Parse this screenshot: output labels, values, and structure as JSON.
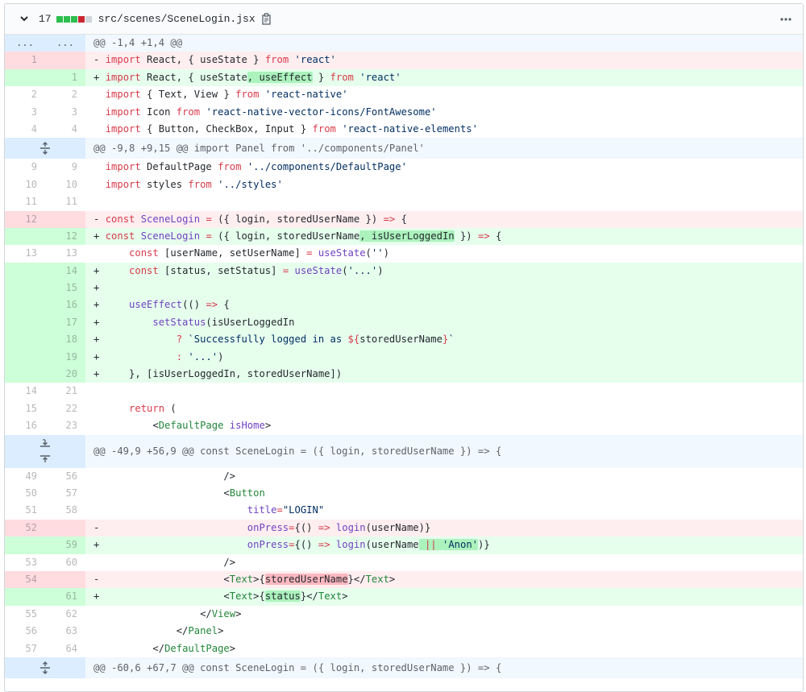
{
  "file": {
    "changes": "17",
    "path": "src/scenes/SceneLogin.jsx",
    "diffstat_colors": [
      "#2cbe4e",
      "#2cbe4e",
      "#2cbe4e",
      "#cb2431",
      "#d1d5da"
    ]
  },
  "header": {
    "dots_old": "...",
    "dots_new": "..."
  },
  "hunks": [
    "@@ -1,4 +1,4 @@",
    "@@ -9,8 +9,15 @@ import Panel from '../components/Panel'",
    "@@ -49,9 +56,9 @@ const SceneLogin = ({ login, storedUserName }) => {",
    "@@ -60,6 +67,7 @@ const SceneLogin = ({ login, storedUserName }) => {"
  ],
  "lines": [
    {
      "old": "1",
      "new": ""
    },
    {
      "old": "",
      "new": "1"
    },
    {
      "old": "2",
      "new": "2"
    },
    {
      "old": "3",
      "new": "3"
    },
    {
      "old": "4",
      "new": "4"
    },
    {
      "old": "9",
      "new": "9"
    },
    {
      "old": "10",
      "new": "10"
    },
    {
      "old": "11",
      "new": "11"
    },
    {
      "old": "12",
      "new": ""
    },
    {
      "old": "",
      "new": "12"
    },
    {
      "old": "13",
      "new": "13"
    },
    {
      "old": "",
      "new": "14"
    },
    {
      "old": "",
      "new": "15"
    },
    {
      "old": "",
      "new": "16"
    },
    {
      "old": "",
      "new": "17"
    },
    {
      "old": "",
      "new": "18"
    },
    {
      "old": "",
      "new": "19"
    },
    {
      "old": "",
      "new": "20"
    },
    {
      "old": "14",
      "new": "21"
    },
    {
      "old": "15",
      "new": "22"
    },
    {
      "old": "16",
      "new": "23"
    },
    {
      "old": "49",
      "new": "56"
    },
    {
      "old": "50",
      "new": "57"
    },
    {
      "old": "51",
      "new": "58"
    },
    {
      "old": "52",
      "new": ""
    },
    {
      "old": "",
      "new": "59"
    },
    {
      "old": "53",
      "new": "60"
    },
    {
      "old": "54",
      "new": ""
    },
    {
      "old": "",
      "new": "61"
    },
    {
      "old": "55",
      "new": "62"
    },
    {
      "old": "56",
      "new": "63"
    },
    {
      "old": "57",
      "new": "64"
    }
  ],
  "code": {
    "l1": [
      "- ",
      "import",
      " React, { useState } ",
      "from",
      " ",
      "'react'"
    ],
    "l2": [
      "+ ",
      "import",
      " React, { useState",
      ", useEffect",
      " } ",
      "from",
      " ",
      "'react'"
    ],
    "l3": [
      "  ",
      "import",
      " { Text, View } ",
      "from",
      " ",
      "'react-native'"
    ],
    "l4": [
      "  ",
      "import",
      " Icon ",
      "from",
      " ",
      "'react-native-vector-icons/FontAwesome'"
    ],
    "l5": [
      "  ",
      "import",
      " { Button, CheckBox, Input } ",
      "from",
      " ",
      "'react-native-elements'"
    ],
    "l6": [
      "  ",
      "import",
      " DefaultPage ",
      "from",
      " ",
      "'../components/DefaultPage'"
    ],
    "l7": [
      "  ",
      "import",
      " styles ",
      "from",
      " ",
      "'../styles'"
    ],
    "l8": [
      ""
    ],
    "l9": [
      "- ",
      "const",
      " ",
      "SceneLogin",
      " ",
      "=",
      " ({ login, storedUserName }) ",
      "=>",
      " {"
    ],
    "l10": [
      "+ ",
      "const",
      " ",
      "SceneLogin",
      " ",
      "=",
      " ({ login, storedUserName",
      ", isUserLoggedIn",
      " }) ",
      "=>",
      " {"
    ],
    "l11": [
      "      ",
      "const",
      " [userName, setUserName] ",
      "=",
      " ",
      "useState",
      "(",
      "''",
      ")"
    ],
    "l12": [
      "+     ",
      "const",
      " [status, setStatus] ",
      "=",
      " ",
      "useState",
      "(",
      "'...'",
      ")"
    ],
    "l13": [
      "+"
    ],
    "l14": [
      "+     ",
      "useEffect",
      "(() ",
      "=>",
      " {"
    ],
    "l15": [
      "+         ",
      "setStatus",
      "(isUserLoggedIn"
    ],
    "l16": [
      "+             ",
      "?",
      " ",
      "`Successfully logged in as ",
      "${",
      "storedUserName",
      "}",
      "`"
    ],
    "l17": [
      "+             ",
      ":",
      " ",
      "'...'",
      ")"
    ],
    "l18": [
      "+     }, [isUserLoggedIn, storedUserName])"
    ],
    "l19": [
      ""
    ],
    "l20": [
      "      ",
      "return",
      " ("
    ],
    "l21": [
      "          <",
      "DefaultPage",
      " ",
      "isHome",
      ">"
    ],
    "l22": [
      "                      />"
    ],
    "l23": [
      "                      <",
      "Button"
    ],
    "l24": [
      "                          ",
      "title",
      "=",
      "\"LOGIN\""
    ],
    "l25": [
      "-                         ",
      "onPress",
      "=",
      "{() ",
      "=>",
      " ",
      "login",
      "(userName)}"
    ],
    "l26": [
      "+                         ",
      "onPress",
      "=",
      "{() ",
      "=>",
      " ",
      "login",
      "(userName",
      " || ",
      "'Anon'",
      ")}"
    ],
    "l27": [
      "                      />"
    ],
    "l28": [
      "-                     <",
      "Text",
      ">{",
      "storedUserName",
      "}</",
      "Text",
      ">"
    ],
    "l29": [
      "+                     <",
      "Text",
      ">{",
      "status",
      "}</",
      "Text",
      ">"
    ],
    "l30": [
      "                  </",
      "View",
      ">"
    ],
    "l31": [
      "              </",
      "Panel",
      ">"
    ],
    "l32": [
      "          </",
      "DefaultPage",
      ">"
    ]
  }
}
